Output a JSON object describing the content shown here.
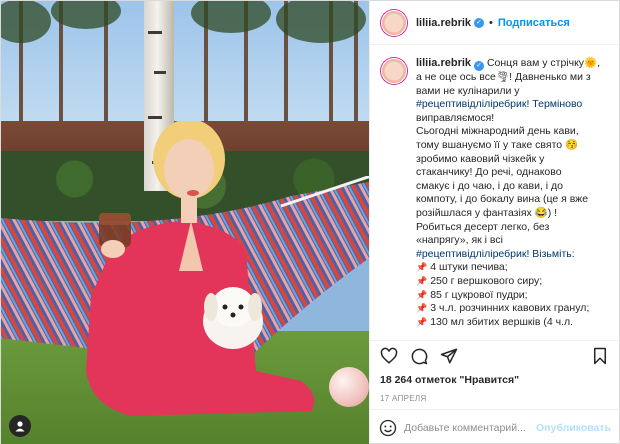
{
  "post": {
    "username": "liliia.rebrik",
    "follow_dot": "•",
    "follow_label": "Подписаться",
    "caption_lines": [
      "Сонця вам у стрічку🌞,",
      "а не оце ось все🌪! Давненько ми з",
      "вами не кулінарили у",
      "#рецептивідліліребрик! Терміново",
      "виправляємося!",
      "Сьогодні міжнародний день кави,",
      "тому вшануємо її у таке свято 😚",
      "зробимо кавовий чізкейк у",
      "стаканчику! До речі, однаково",
      "смакує і до чаю, і до кави, і до",
      "компоту, і до бокалу вина (це я вже",
      "розійшлася у фантазіях 😂) !",
      "Робиться десерт легко, без",
      "«напрягу», як і всі",
      "#рецептивідліліребрик! Візьміть:"
    ],
    "ingredients": [
      "4 штуки печива;",
      "250 г вершкового сиру;",
      "85 г цукрової пудри;",
      "3 ч.л. розчинних кавових гранул;",
      "130 мл збитих вершків (4 ч.л."
    ],
    "likes": "18 264 отметок \"Нравится\"",
    "date": "17 АПРЕЛЯ",
    "comment_placeholder": "Добавьте комментарий...",
    "publish_label": "Опубликовать"
  },
  "icons": {
    "verified": "verified-badge-icon",
    "like": "heart-icon",
    "comment": "comment-icon",
    "share": "paper-plane-icon",
    "save": "bookmark-icon",
    "emoji": "smiley-icon",
    "user_tag": "person-tag-icon",
    "pin": "pushpin-icon"
  },
  "colors": {
    "link": "#0095f6",
    "hashtag": "#00376b",
    "verified": "#3897f0",
    "muted": "#8e8e8e",
    "publish_disabled": "#b2dffc"
  }
}
